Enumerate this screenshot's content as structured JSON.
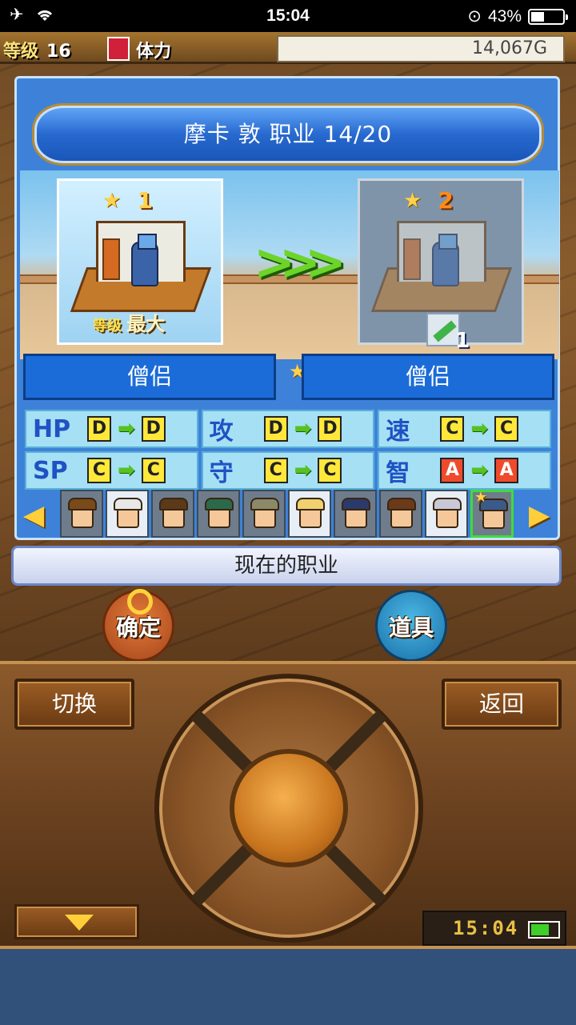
{
  "status_bar": {
    "time": "15:04",
    "battery": "43%",
    "battery_level": 0.43
  },
  "hud": {
    "level_label": "等级",
    "level_value": "16",
    "hp_label": "体力",
    "money": "14,067G"
  },
  "dialog": {
    "title": "摩卡 敦 职业 14/20",
    "current": {
      "rank": "1",
      "level_label": "等级",
      "level_value": "最大",
      "job": "僧侣"
    },
    "next": {
      "rank": "2",
      "item_count": "1",
      "job": "僧侣"
    },
    "stats": [
      {
        "label": "HP",
        "from": "D",
        "to": "D",
        "from_color": "yellow",
        "to_color": "yellow"
      },
      {
        "label": "攻",
        "from": "D",
        "to": "D",
        "from_color": "yellow",
        "to_color": "yellow"
      },
      {
        "label": "速",
        "from": "C",
        "to": "C",
        "from_color": "yellow",
        "to_color": "yellow"
      },
      {
        "label": "SP",
        "from": "C",
        "to": "C",
        "from_color": "yellow",
        "to_color": "yellow"
      },
      {
        "label": "守",
        "from": "C",
        "to": "C",
        "from_color": "yellow",
        "to_color": "yellow"
      },
      {
        "label": "智",
        "from": "A",
        "to": "A",
        "from_color": "red",
        "to_color": "red"
      }
    ],
    "portraits": [
      {
        "hair": "#7a4a1a",
        "bg": "dark"
      },
      {
        "hair": "#e8e8e8",
        "bg": "light"
      },
      {
        "hair": "#5a3a1a",
        "bg": "dark"
      },
      {
        "hair": "#2a6a4a",
        "bg": "dark"
      },
      {
        "hair": "#8a8a6a",
        "bg": "dark"
      },
      {
        "hair": "#f0d070",
        "bg": "light"
      },
      {
        "hair": "#2a3a6a",
        "bg": "dark"
      },
      {
        "hair": "#6a3a1a",
        "bg": "dark"
      },
      {
        "hair": "#c8c8d8",
        "bg": "light"
      },
      {
        "hair": "#3a5a8a",
        "bg": "dark",
        "selected": true,
        "starred": true
      }
    ]
  },
  "current_job_button": "现在的职业",
  "buttons": {
    "confirm": "确定",
    "items": "道具",
    "switch": "切换",
    "back": "返回"
  },
  "pad_clock": {
    "time": "15:04",
    "battery_level": 0.7
  }
}
